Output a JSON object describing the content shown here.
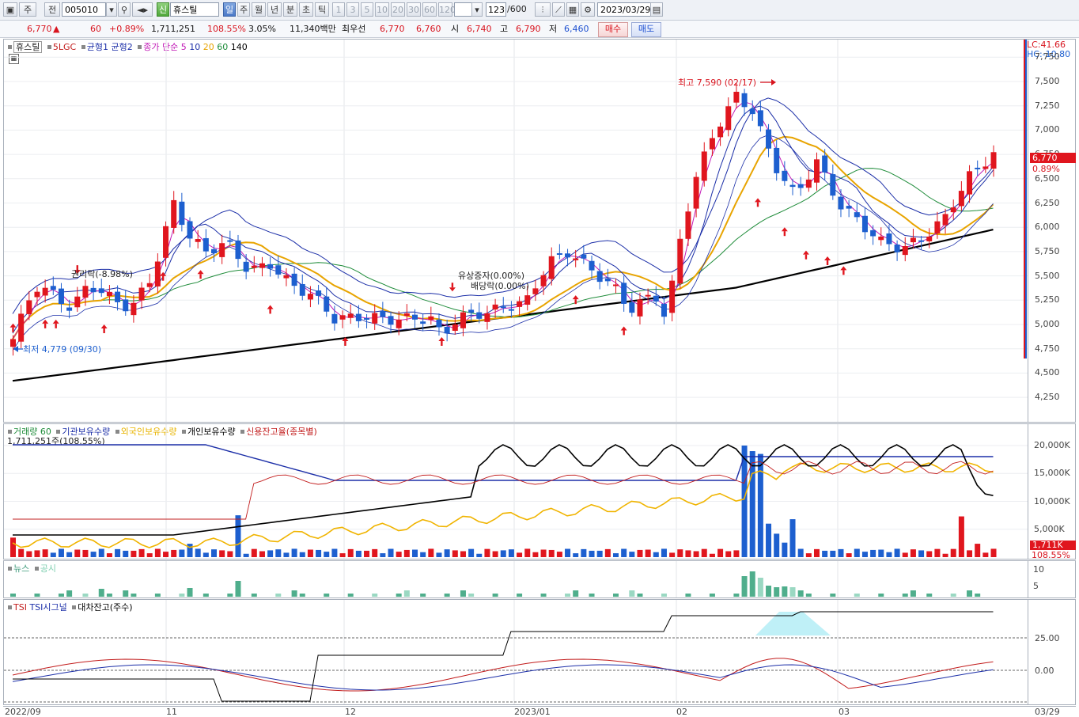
{
  "toolbar": {
    "market": "주",
    "market_scope": "전",
    "code": "005010",
    "badge": "신",
    "name": "휴스틸",
    "periods": [
      "일",
      "주",
      "월",
      "년",
      "분",
      "초",
      "틱"
    ],
    "active_period": "일",
    "intervals": [
      "1",
      "3",
      "5",
      "10",
      "20",
      "30",
      "60",
      "120"
    ],
    "count": "123",
    "count_total": "/600",
    "date": "2023/03/29"
  },
  "quote": {
    "price": "6,770",
    "up_arrow": "▲",
    "change": "60",
    "change_pct": "+0.89%",
    "volume": "1,711,251",
    "volume_ratio": "108.55%",
    "turnover": "3.05%",
    "amount": "11,340백만",
    "broker": "최우선",
    "ask": "6,770",
    "bid": "6,760",
    "open_label": "시",
    "open": "6,740",
    "high_label": "고",
    "high": "6,790",
    "low_label": "저",
    "low": "6,460",
    "buy_label": "매수",
    "sell_label": "매도"
  },
  "price_panel": {
    "legend": [
      "휴스틸",
      "5LGC",
      "균형1",
      "균형2",
      "종가 단순",
      "5",
      "10",
      "20",
      "60",
      "140"
    ],
    "lc": "LC:41.66",
    "hc": "HC:-10.80",
    "price_tag": "6,770",
    "pct_tag": "0.89%",
    "hi_label": "최고 7,590 (02/17)",
    "lo_label": "최저 4,779 (09/30)",
    "ann_rights": "권리락(-8.98%)",
    "ann_capital": "유상증자(0.00%)",
    "ann_dividend": "배당락(0.00%)",
    "y_ticks": [
      "7,750",
      "7,500",
      "7,250",
      "7,000",
      "6,750",
      "6,500",
      "6,250",
      "6,000",
      "5,750",
      "5,500",
      "5,250",
      "5,000",
      "4,750",
      "4,500",
      "4,250"
    ]
  },
  "volume_panel": {
    "legend": [
      "거래량",
      "60",
      "기관보유수량",
      "외국인보유수량",
      "개인보유수량",
      "신용잔고율(종목별)"
    ],
    "vol_readout": "1,711,251주(108.55%)",
    "y_ticks": [
      "20,000K",
      "15,000K",
      "10,000K",
      "5,000K"
    ],
    "vol_tag": "1,711K",
    "ratio_tag": "108.55%"
  },
  "news_panel": {
    "legend": [
      "뉴스",
      "공시"
    ],
    "y_ticks": [
      "10",
      "5"
    ]
  },
  "tsi_panel": {
    "legend": [
      "TSI",
      "TSI시그널",
      "대차잔고(주수)"
    ],
    "y_ticks": [
      "25.00",
      "0.00"
    ]
  },
  "x_axis": [
    "2022/09",
    "11",
    "12",
    "2023/01",
    "02",
    "03",
    "03/29"
  ],
  "colors": {
    "up": "#e0161e",
    "down": "#1d5fcf",
    "ma5": "#c21cb7",
    "ma10": "#1c2fa8",
    "ma20": "#e8a400",
    "ma60": "#1f8c3a",
    "ma140": "#000000",
    "news": "#4fae8c"
  }
}
